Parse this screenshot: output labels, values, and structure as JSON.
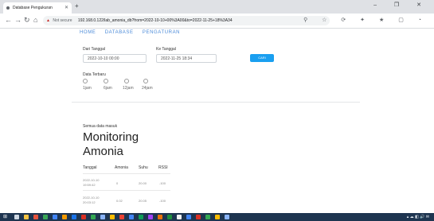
{
  "browser": {
    "tab_title": "Database Pengukuran",
    "new_tab_symbol": "+",
    "window_controls": "– ❐ ✕",
    "not_secure": "Not secure",
    "url": "192.168.0.122/lab_amonia_db?from=2022-10-10+00%3A00&to=2022-11-25+18%3A34",
    "toolbar_icons": "⚲ ☆ ⟳ ✦ ★ ▢ ◔"
  },
  "nav": {
    "home": "HOME",
    "database": "DATABASE",
    "pengaturan": "PENGATURAN"
  },
  "filter": {
    "from_label": "Dari Tanggal",
    "from_value": "2022-10-10 00:00",
    "to_label": "Ke Tanggal",
    "to_value": "2022-11-25 18:34",
    "search_button": "CARI"
  },
  "recent": {
    "label": "Data Terbaru",
    "options": [
      "1jam",
      "6jam",
      "12jam",
      "24jam"
    ]
  },
  "section": {
    "sub": "Semua data masuk",
    "title_line1": "Monitoring",
    "title_line2": "Amonia"
  },
  "table": {
    "headers": [
      "Tanggal",
      "Amonia",
      "Suhu",
      "RSSI"
    ],
    "rows": [
      [
        "2022-10-10 19:59:42",
        "0",
        "20.00",
        "-100"
      ],
      [
        "2022-10-10 20:03:12",
        "0.02",
        "20.05",
        "-100"
      ]
    ]
  },
  "colors": {
    "accent": "#1a9ff0",
    "nav": "#4a8ad8",
    "taskbar": "#1e3550"
  }
}
